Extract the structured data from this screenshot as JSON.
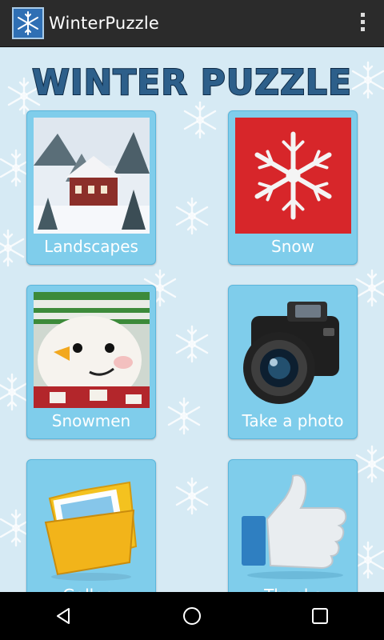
{
  "app_bar": {
    "title": "WinterPuzzle",
    "icon": "snowflake-icon",
    "overflow_icon": "more-vert-icon"
  },
  "banner": {
    "text": "WINTER PUZZLE"
  },
  "tiles": [
    {
      "label": "Landscapes",
      "icon": "winter-landscape-image"
    },
    {
      "label": "Snow",
      "icon": "snowflake-image"
    },
    {
      "label": "Snowmen",
      "icon": "snowman-image"
    },
    {
      "label": "Take a photo",
      "icon": "camera-icon"
    },
    {
      "label": "Gallery",
      "icon": "folder-gallery-icon"
    },
    {
      "label": "Thanks",
      "icon": "thumbs-up-icon"
    }
  ],
  "nav": {
    "back_icon": "back-icon",
    "home_icon": "home-icon",
    "recents_icon": "recents-icon"
  },
  "colors": {
    "app_bar": "#2b2b2b",
    "tile": "#7fcdeb",
    "background": "#d6eaf4",
    "banner_text": "#2d5f8a"
  }
}
